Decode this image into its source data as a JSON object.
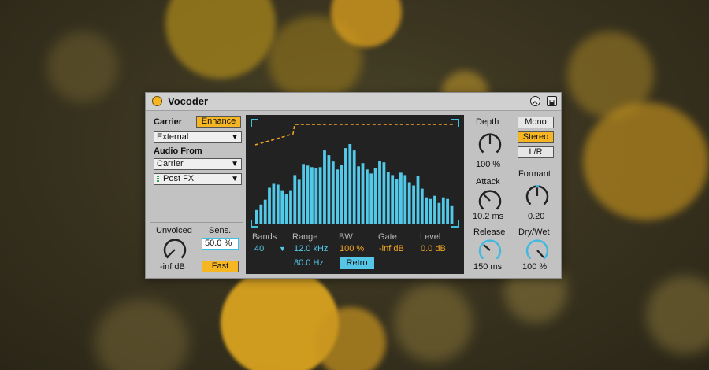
{
  "device": {
    "title": "Vocoder",
    "carrier_label": "Carrier",
    "enhance_label": "Enhance",
    "carrier_select": "External",
    "audio_from_label": "Audio From",
    "audio_from_select": "Carrier",
    "tap_select": "Post FX",
    "unvoiced_label": "Unvoiced",
    "unvoiced_value": "-inf dB",
    "sens_label": "Sens.",
    "sens_value": "50.0 %",
    "fast_label": "Fast",
    "display": {
      "bands_label": "Bands",
      "bands_value": "40",
      "range_label": "Range",
      "range_high": "12.0 kHz",
      "range_low": "80.0 Hz",
      "bw_label": "BW",
      "bw_value": "100 %",
      "gate_label": "Gate",
      "gate_value": "-inf dB",
      "level_label": "Level",
      "level_value": "0.0 dB",
      "retro_label": "Retro",
      "bar_levels": [
        0.17,
        0.24,
        0.3,
        0.45,
        0.5,
        0.49,
        0.42,
        0.37,
        0.42,
        0.61,
        0.55,
        0.75,
        0.73,
        0.71,
        0.7,
        0.71,
        0.92,
        0.86,
        0.78,
        0.68,
        0.74,
        0.95,
        1.0,
        0.92,
        0.72,
        0.76,
        0.68,
        0.63,
        0.7,
        0.79,
        0.77,
        0.65,
        0.61,
        0.56,
        0.64,
        0.61,
        0.52,
        0.48,
        0.6,
        0.44,
        0.33,
        0.31,
        0.35,
        0.26,
        0.33,
        0.31,
        0.22
      ]
    },
    "depth_label": "Depth",
    "depth_value": "100 %",
    "attack_label": "Attack",
    "attack_value": "10.2 ms",
    "release_label": "Release",
    "release_value": "150 ms",
    "mono_label": "Mono",
    "stereo_label": "Stereo",
    "lr_label": "L/R",
    "formant_label": "Formant",
    "formant_value": "0.20",
    "drywet_label": "Dry/Wet",
    "drywet_value": "100 %"
  },
  "colors": {
    "accent": "#f5b622",
    "cyan": "#52c9e8",
    "panel": "#c2c2c2",
    "display_bg": "#222222"
  }
}
